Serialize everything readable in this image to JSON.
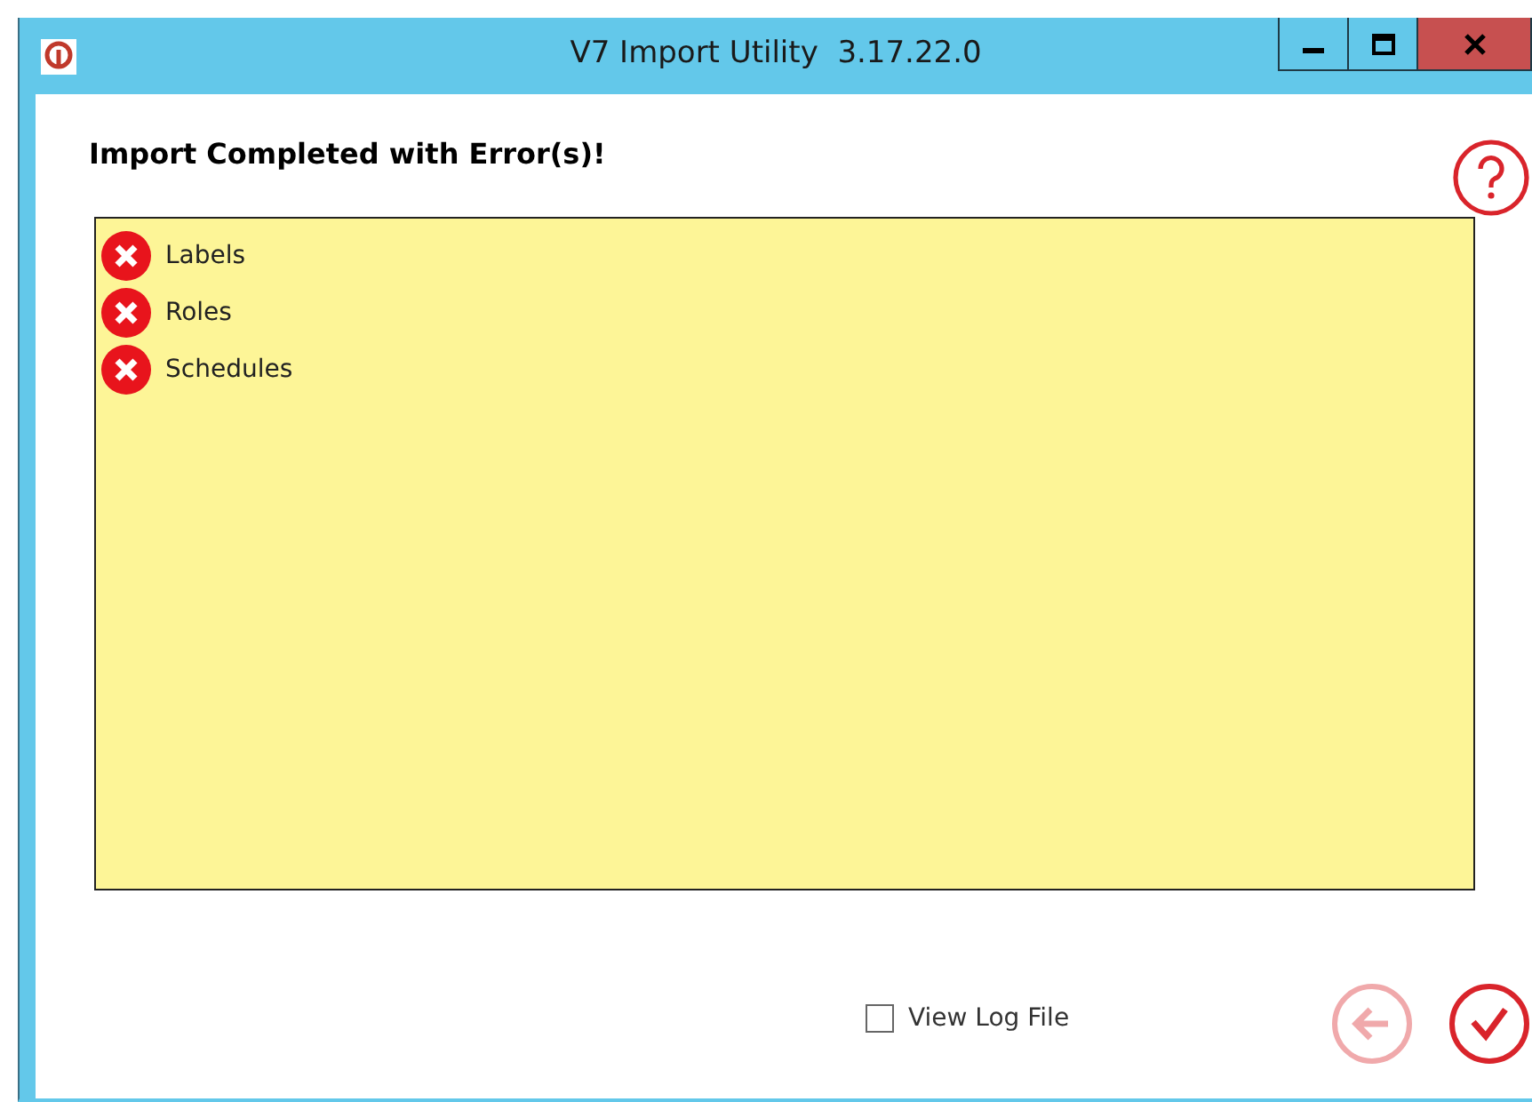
{
  "window": {
    "title": "V7 Import Utility  3.17.22.0"
  },
  "heading": "Import Completed with Error(s)!",
  "results": [
    {
      "label": "Labels",
      "kind": "error"
    },
    {
      "label": "Roles",
      "kind": "error"
    },
    {
      "label": "Schedules",
      "kind": "error"
    }
  ],
  "view_log": {
    "label": "View Log File",
    "checked": false
  },
  "back_button": {
    "disabled": true
  },
  "finish_button": {
    "disabled": false
  }
}
